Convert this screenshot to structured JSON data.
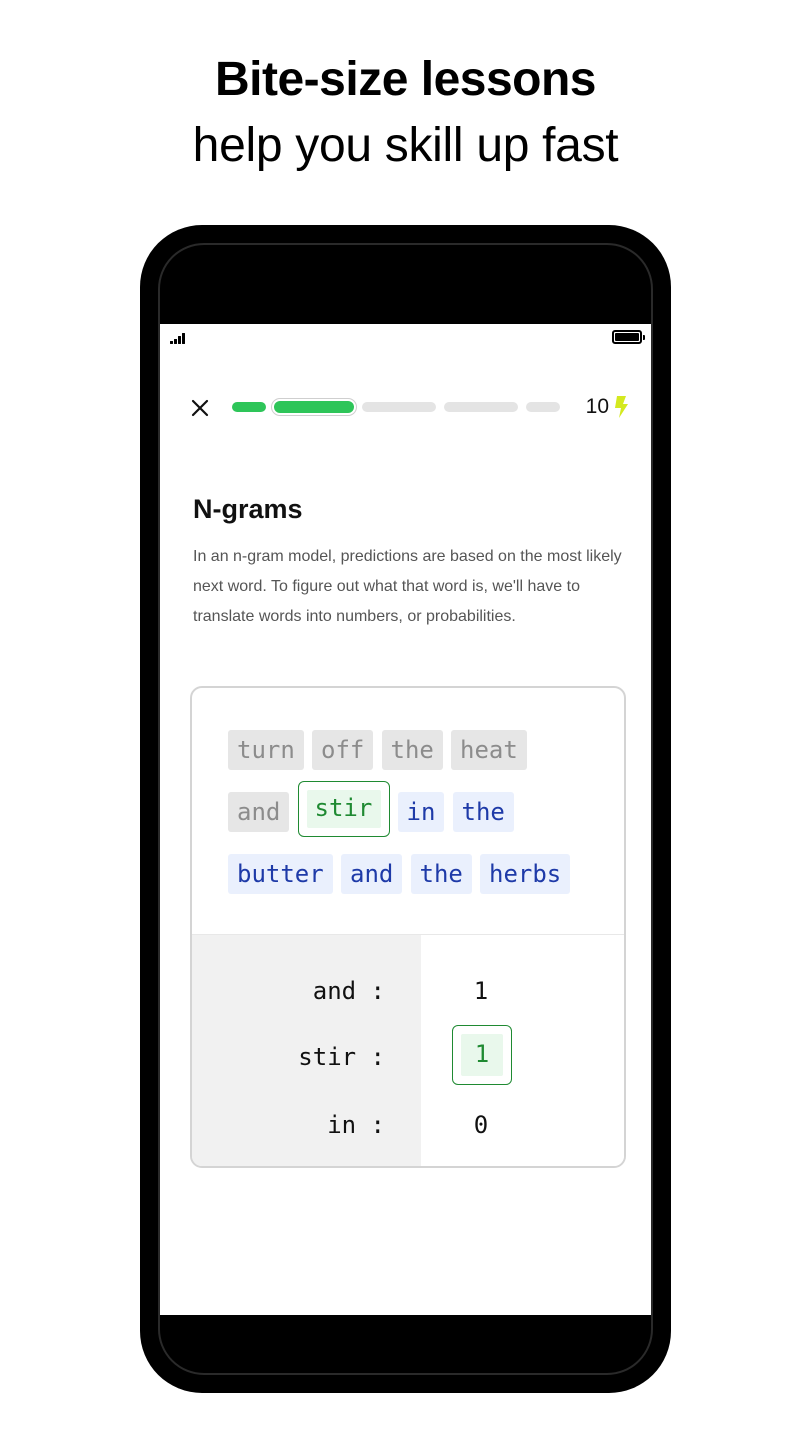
{
  "headline": {
    "line1": "Bite-size lessons",
    "line2": "help you skill up fast"
  },
  "status_bar": {
    "signal_icon": "signal-bars-icon",
    "battery_icon": "battery-full-icon",
    "battery_level": 1.0
  },
  "lesson_header": {
    "close_icon": "close-icon",
    "progress": {
      "segments_total": 5,
      "segments_completed": 1,
      "current_segment": 2,
      "colors": {
        "done": "#2ec559",
        "remaining": "#e4e4e4"
      }
    },
    "energy": {
      "count": "10",
      "icon": "lightning-bolt-icon",
      "color": "#d4e91f"
    }
  },
  "lesson": {
    "title": "N-grams",
    "body": "In an n-gram model, predictions are based on the most likely next word. To figure out what that word is, we'll have to translate words into numbers, or probabilities."
  },
  "sentence": {
    "rows": [
      [
        {
          "text": "turn",
          "state": "past"
        },
        {
          "text": "off",
          "state": "past"
        },
        {
          "text": "the",
          "state": "past"
        },
        {
          "text": "heat",
          "state": "past"
        }
      ],
      [
        {
          "text": "and",
          "state": "past"
        },
        {
          "text": "stir",
          "state": "focus"
        },
        {
          "text": "in",
          "state": "future"
        },
        {
          "text": "the",
          "state": "future"
        }
      ],
      [
        {
          "text": "butter",
          "state": "future"
        },
        {
          "text": "and",
          "state": "future"
        },
        {
          "text": "the",
          "state": "future"
        },
        {
          "text": "herbs",
          "state": "future"
        }
      ]
    ],
    "colors": {
      "focus": "#1f8a32",
      "future": "#1e3aa8",
      "past": "#8c8c8c"
    }
  },
  "counts": {
    "rows": [
      {
        "word": "and :",
        "value": "1",
        "highlighted": false
      },
      {
        "word": "stir :",
        "value": "1",
        "highlighted": true
      },
      {
        "word": "in :",
        "value": "0",
        "highlighted": false
      }
    ]
  }
}
